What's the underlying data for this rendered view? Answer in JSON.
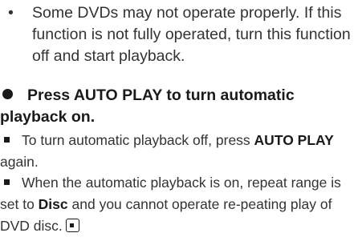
{
  "note": {
    "bullet": "•",
    "text": "Some DVDs may not operate properly. If this function is not fully operated, turn this function off and start playback."
  },
  "step": {
    "heading": "Press AUTO PLAY to turn automatic playback on."
  },
  "items": [
    {
      "text_before": "To turn automatic playback off, press ",
      "bold": "AUTO PLAY",
      "text_after": " again."
    },
    {
      "text_before": "When the automatic playback is on, repeat range is set to ",
      "bold": "Disc",
      "text_after": " and you cannot operate re-peating play of DVD disc."
    }
  ],
  "end_mark_icon": "end-of-section-icon"
}
